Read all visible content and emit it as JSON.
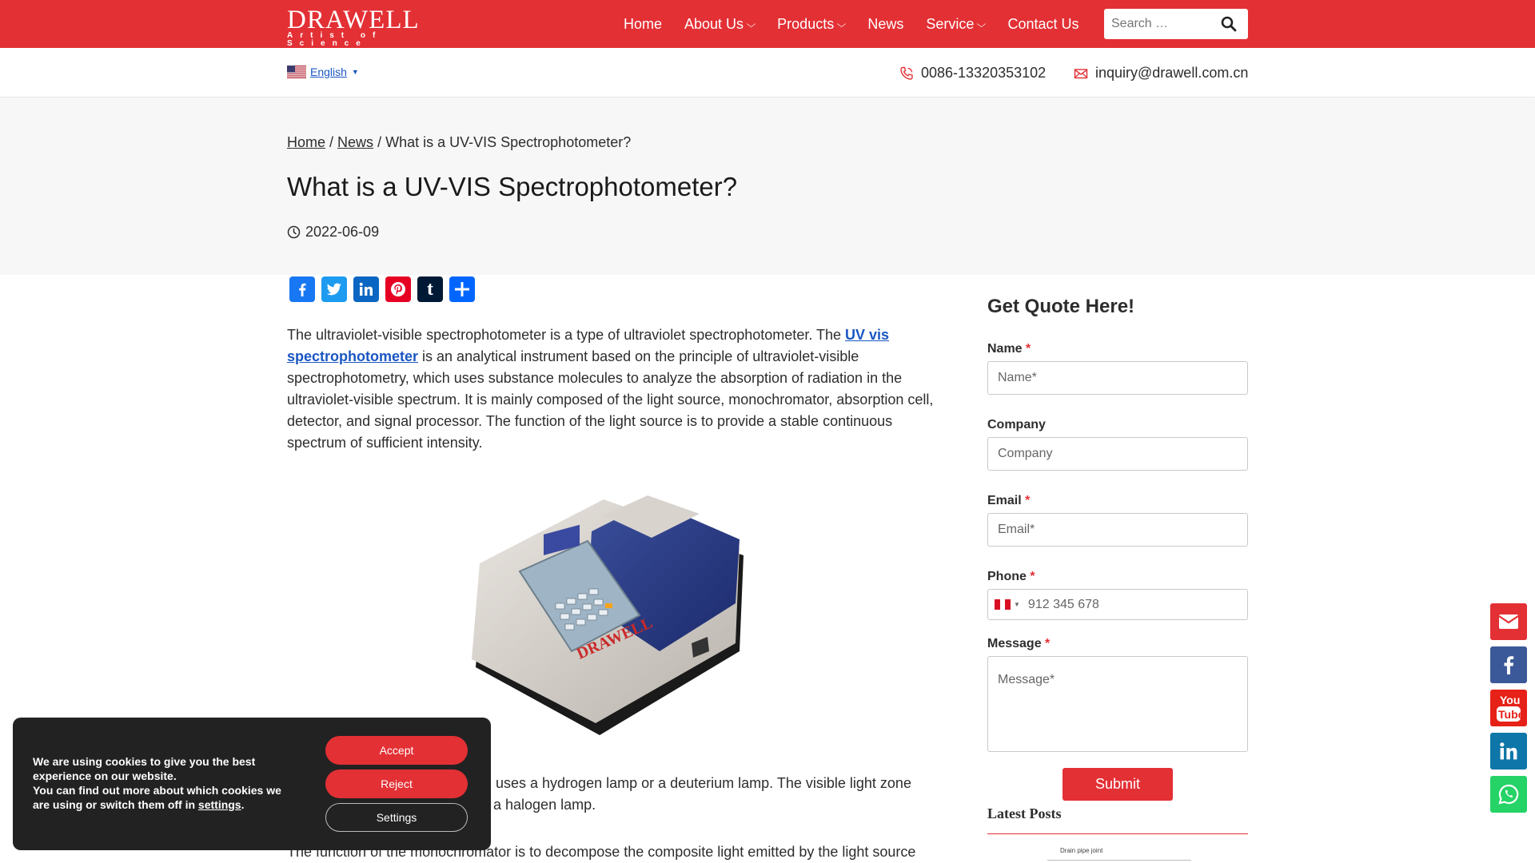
{
  "header": {
    "logo_main": "DRAWELL",
    "logo_tagline": "Artist of Science",
    "nav": [
      {
        "label": "Home",
        "dropdown": false
      },
      {
        "label": "About Us",
        "dropdown": true
      },
      {
        "label": "Products",
        "dropdown": true
      },
      {
        "label": "News",
        "dropdown": false
      },
      {
        "label": "Service",
        "dropdown": true
      },
      {
        "label": "Contact Us",
        "dropdown": false
      }
    ],
    "search_placeholder": "Search …"
  },
  "subbar": {
    "language": "English",
    "phone": "0086-13320353102",
    "email": "inquiry@drawell.com.cn"
  },
  "hero": {
    "breadcrumb_home": "Home",
    "breadcrumb_news": "News",
    "breadcrumb_current": "What is a UV-VIS Spectrophotometer?",
    "title": "What is a UV-VIS Spectrophotometer?",
    "date": "2022-06-09"
  },
  "share": [
    "Facebook",
    "Twitter",
    "LinkedIn",
    "Pinterest",
    "Tumblr",
    "Share"
  ],
  "article": {
    "p1_before": "The ultraviolet-visible spectrophotometer is a type of ultraviolet spectrophotometer. The ",
    "p1_link": "UV vis spectrophotometer",
    "p1_after": " is an analytical instrument based on the principle of ultraviolet-visible spectrophotometry, which uses substance molecules to analyze the absorption of radiation in the ultraviolet-visible spectrum. It is mainly composed of the light source, monochromator, absorption cell, detector, and signal processor. The function of the light source is to provide a stable continuous spectrum of sufficient intensity.",
    "p2_visible": "uses a hydrogen lamp or a deuterium lamp. The visible light zone a halogen lamp.",
    "p2_line1": "uses a hydrogen lamp or a deuterium lamp. The visible light zone",
    "p2_line2": "a halogen lamp.",
    "p3_visible": "The function of the monochromator is to decompose the composite light emitted by the light source",
    "image_brand": "DRAWELL"
  },
  "quote_form": {
    "title": "Get Quote Here!",
    "name_label": "Name",
    "name_placeholder": "Name*",
    "company_label": "Company",
    "company_placeholder": "Company",
    "email_label": "Email",
    "email_placeholder": "Email*",
    "phone_label": "Phone",
    "phone_placeholder": "912 345 678",
    "message_label": "Message",
    "message_placeholder": "Message*",
    "required_mark": "*",
    "submit_label": "Submit"
  },
  "latest_posts": {
    "title": "Latest Posts",
    "thumb_caption": "Drain pipe joint"
  },
  "cookie": {
    "line1": "We are using cookies to give you the best experience on our website.",
    "line2_before": "You can find out more about which cookies we are using or switch them off in ",
    "line2_link": "settings",
    "line2_after": ".",
    "accept": "Accept",
    "reject": "Reject",
    "settings": "Settings"
  },
  "colors": {
    "brand_red": "#e33035",
    "link_blue": "#1a56c2",
    "facebook": "#1877f2",
    "twitter": "#1d9bf0",
    "linkedin": "#0a66c2",
    "pinterest": "#e60023",
    "tumblr": "#001935",
    "share": "#0166ff"
  },
  "floating_social": [
    "mail-icon",
    "facebook-icon",
    "youtube-icon",
    "linkedin-icon",
    "whatsapp-icon"
  ]
}
